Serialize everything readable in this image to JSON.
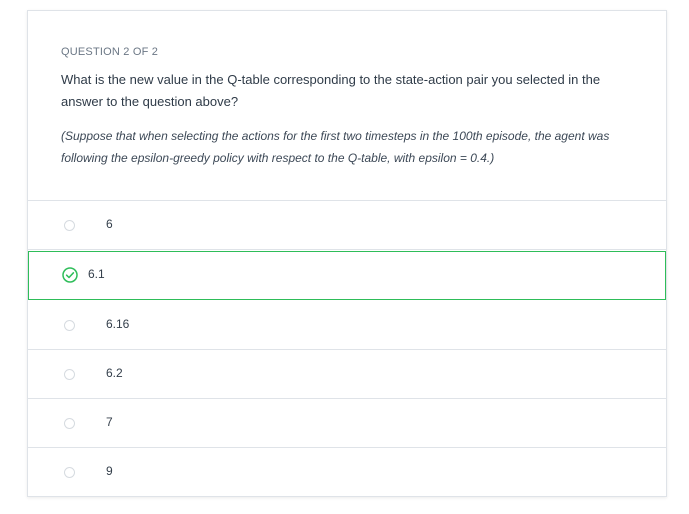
{
  "question": {
    "header": "QUESTION 2 OF 2",
    "text": "What is the new value in the Q-table corresponding to the state-action pair you selected in the answer to the question above?",
    "note": "(Suppose that when selecting the actions for the first two timesteps in the 100th episode, the agent was following the epsilon-greedy policy with respect to the Q-table, with epsilon = 0.4.)"
  },
  "options": [
    {
      "label": "6",
      "selected": false
    },
    {
      "label": "6.1",
      "selected": true
    },
    {
      "label": "6.16",
      "selected": false
    },
    {
      "label": "6.2",
      "selected": false
    },
    {
      "label": "7",
      "selected": false
    },
    {
      "label": "9",
      "selected": false
    }
  ],
  "colors": {
    "selected_accent": "#2ebd59",
    "border": "#dfe3e8"
  }
}
